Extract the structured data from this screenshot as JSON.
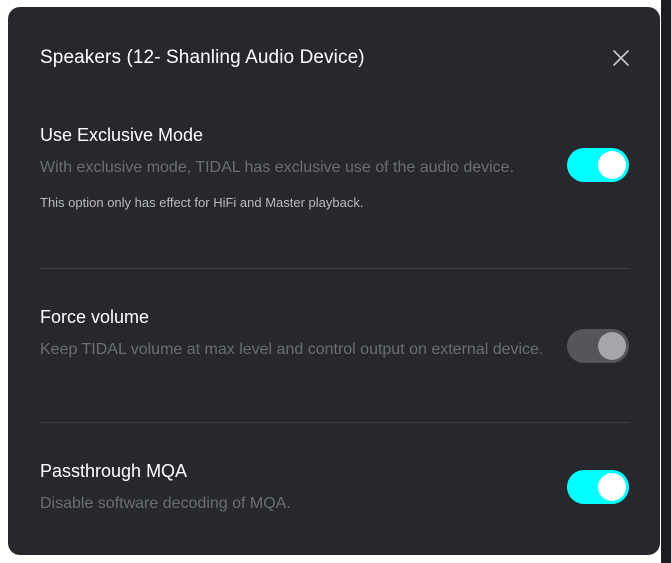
{
  "dialog": {
    "title": "Speakers (12- Shanling Audio Device)",
    "close_icon": "close-icon"
  },
  "settings": [
    {
      "title": "Use Exclusive Mode",
      "description": "With exclusive mode, TIDAL has exclusive use of the audio device.",
      "note": "This option only has effect for HiFi and Master playback.",
      "enabled": true
    },
    {
      "title": "Force volume",
      "description": "Keep TIDAL volume at max level and control output on external device.",
      "enabled": false
    },
    {
      "title": "Passthrough MQA",
      "description": "Disable software decoding of MQA.",
      "enabled": true
    }
  ],
  "colors": {
    "dialog_bg": "#27282d",
    "accent": "#01ffff",
    "toggle_off": "#55565b",
    "muted_text": "#6c6e76"
  }
}
